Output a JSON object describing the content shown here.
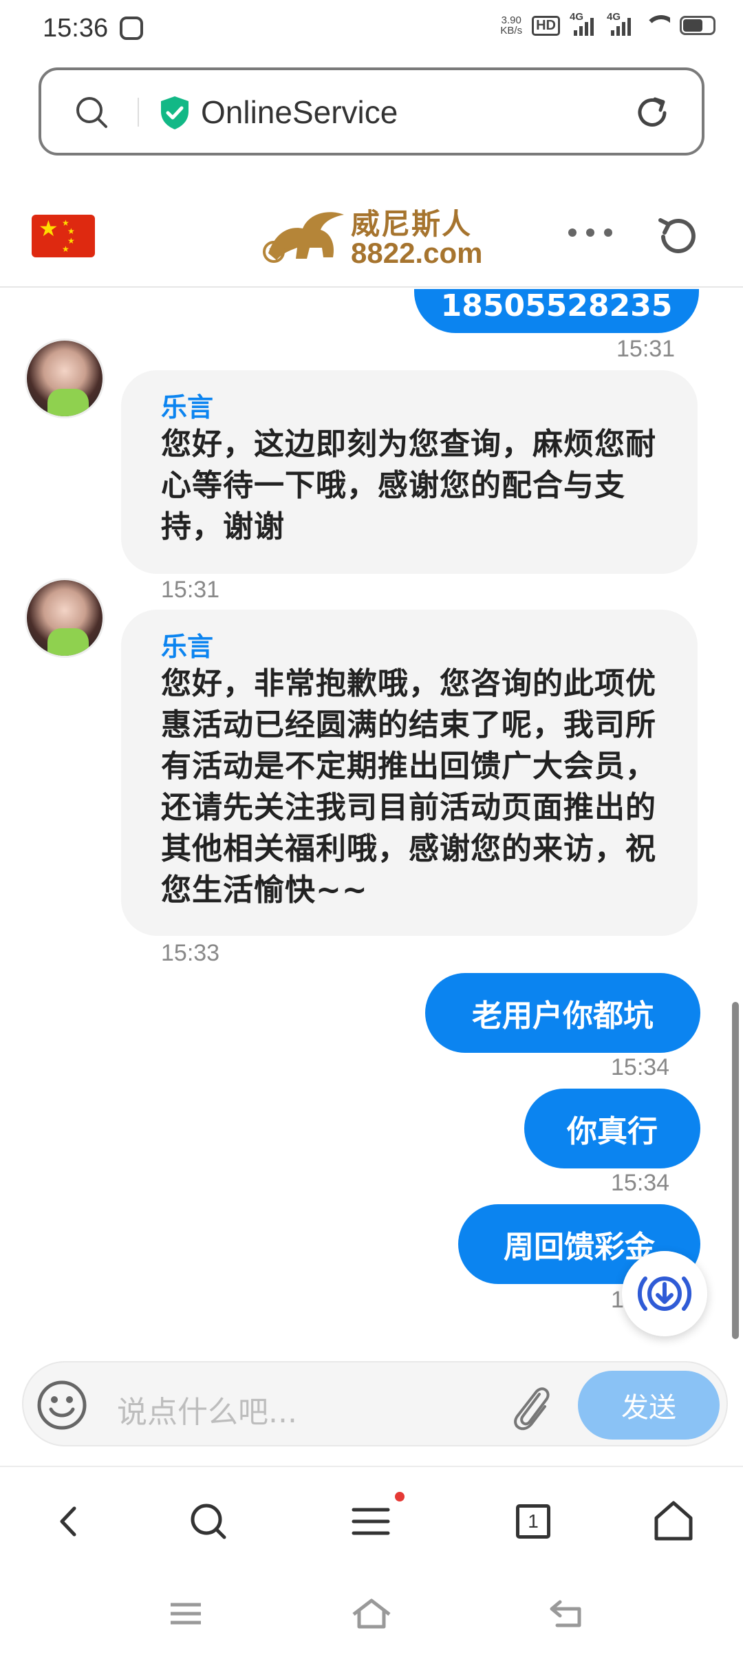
{
  "status_bar": {
    "time": "15:36",
    "speed_value": "3.90",
    "speed_unit": "KB/s",
    "hd": "HD",
    "net1": "4G",
    "net2": "4G"
  },
  "url_bar": {
    "site_name": "OnlineService"
  },
  "header": {
    "logo_cn": "威尼斯人",
    "logo_domain": "8822.com"
  },
  "messages": [
    {
      "type": "out",
      "text": "18505528235",
      "time": "15:31"
    },
    {
      "type": "in",
      "sender": "乐言",
      "text": "您好，这边即刻为您查询，麻烦您耐心等待一下哦，感谢您的配合与支持，谢谢",
      "time": "15:31"
    },
    {
      "type": "in",
      "sender": "乐言",
      "text": "您好，非常抱歉哦，您咨询的此项优惠活动已经圆满的结束了呢，我司所有活动是不定期推出回馈广大会员，还请先关注我司目前活动页面推出的其他相关福利哦，感谢您的来访，祝您生活愉快~~",
      "time": "15:33"
    },
    {
      "type": "out",
      "text": "老用户你都坑",
      "time": "15:34"
    },
    {
      "type": "out",
      "text": "你真行",
      "time": "15:34"
    },
    {
      "type": "out",
      "text": "周回馈彩金",
      "time": "1"
    }
  ],
  "input": {
    "placeholder": "说点什么吧...",
    "send_label": "发送"
  },
  "bottom_nav": {
    "tab_count": "1"
  },
  "colors": {
    "accent": "#0b84f0",
    "send_disabled": "#8ac2f5",
    "incoming_bg": "#f4f4f4"
  }
}
